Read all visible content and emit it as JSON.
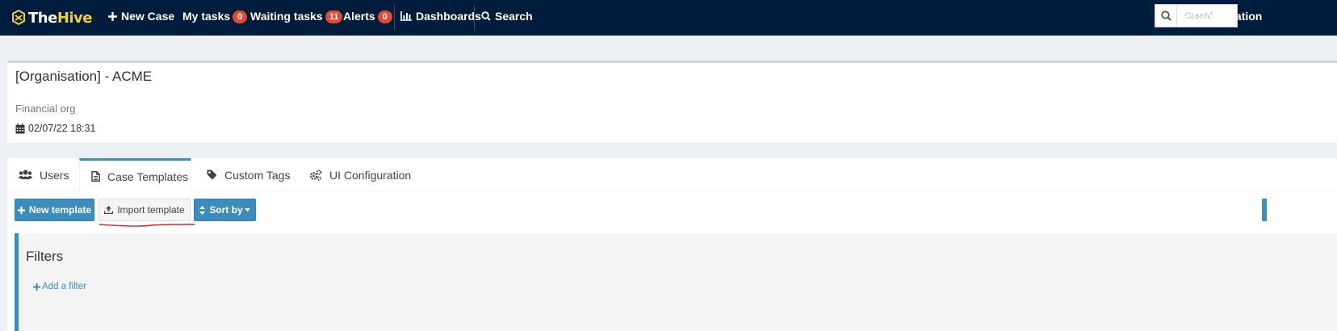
{
  "navbar": {
    "brand": {
      "part1": "The",
      "part2": "Hive"
    },
    "new_case": "New Case",
    "my_tasks": {
      "label": "My tasks",
      "count": "0"
    },
    "waiting_tasks": {
      "label": "Waiting tasks",
      "count": "11"
    },
    "alerts": {
      "label": "Alerts",
      "count": "0"
    },
    "dashboards": "Dashboards",
    "search": "Search",
    "case_search_placeholder": "CaseId",
    "organisation": "Organisation"
  },
  "org": {
    "title": "[Organisation] - ACME",
    "description": "Financial org",
    "date": "02/07/22 18:31"
  },
  "tabs": [
    {
      "label": "Users",
      "icon": "users-icon"
    },
    {
      "label": "Case Templates",
      "icon": "file-icon",
      "active": true
    },
    {
      "label": "Custom Tags",
      "icon": "tag-icon"
    },
    {
      "label": "UI Configuration",
      "icon": "cogs-icon"
    }
  ],
  "toolbar": {
    "new_template": "New template",
    "import_template": "Import template",
    "sort_by": "Sort by"
  },
  "filters": {
    "title": "Filters",
    "add_filter": "Add a filter"
  },
  "colors": {
    "navbar": "#001c3c",
    "accent": "#3c8dbc",
    "badge": "#e34a32",
    "brand_yellow": "#f3d02f",
    "annotation": "#d9232e"
  }
}
